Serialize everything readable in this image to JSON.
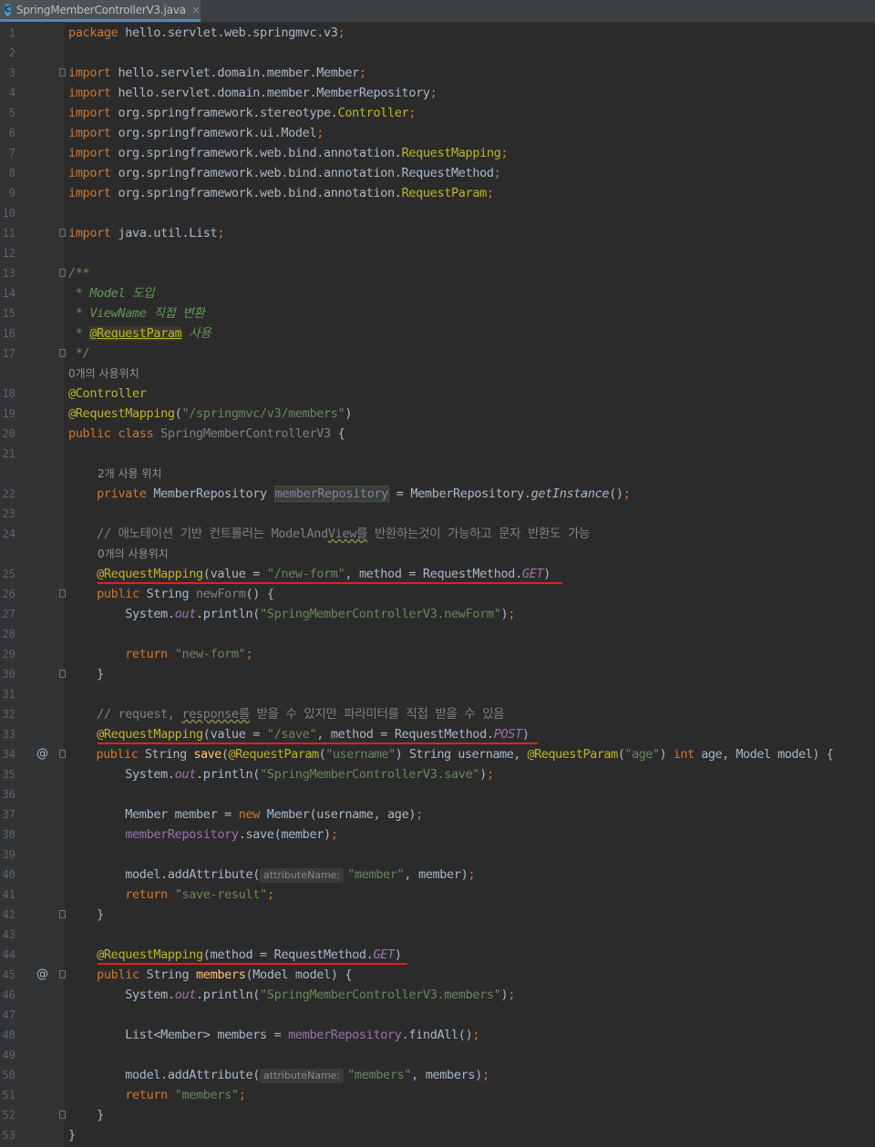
{
  "tab": {
    "icon_letter": "C",
    "title": "SpringMemberControllerV3.java",
    "close": "×"
  },
  "hints": {
    "h1": "0개의 사용위치",
    "h2": "2개 사용 위치",
    "h3": "0개의 사용위치"
  },
  "inlay_hint": "attributeName:",
  "line_numbers": [
    "1",
    "2",
    "3",
    "4",
    "5",
    "6",
    "7",
    "8",
    "9",
    "10",
    "11",
    "12",
    "13",
    "14",
    "15",
    "16",
    "17",
    "18",
    "19",
    "20",
    "21",
    "22",
    "23",
    "24",
    "25",
    "26",
    "27",
    "28",
    "29",
    "30",
    "31",
    "32",
    "33",
    "34",
    "35",
    "36",
    "37",
    "38",
    "39",
    "40",
    "41",
    "42",
    "43",
    "44",
    "45",
    "46",
    "47",
    "48",
    "49",
    "50",
    "51",
    "52",
    "53"
  ],
  "code": {
    "package_kw": "package",
    "package_name": " hello.servlet.web.springmvc.v3",
    "import_kw": "import",
    "imp1": " hello.servlet.domain.member.Member",
    "imp2": " hello.servlet.domain.member.MemberRepository",
    "imp3_pre": " org.springframework.stereotype.",
    "imp3_cls": "Controller",
    "imp4": " org.springframework.ui.Model",
    "imp5_pre": " org.springframework.web.bind.annotation.",
    "imp5_cls": "RequestMapping",
    "imp6": " org.springframework.web.bind.annotation.RequestMethod",
    "imp7_pre": " org.springframework.web.bind.annotation.",
    "imp7_cls": "RequestParam",
    "imp8": " java.util.List",
    "semi": ";",
    "doc_open": "/**",
    "doc1": " * Model 도입",
    "doc2": " * ViewName 직접 변환",
    "doc3_pre": " * ",
    "doc3_tag": "@RequestParam",
    "doc3_post": " 사용",
    "doc_close": " */",
    "ann_controller": "@Controller",
    "ann_reqmap": "@RequestMapping",
    "class_path": "\"/springmvc/v3/members\"",
    "public": "public",
    "class": "class",
    "class_name": " SpringMemberControllerV3 ",
    "private": "private",
    "repo_type": " MemberRepository ",
    "repo_field": "memberRepository",
    "repo_init": " = MemberRepository.",
    "get_instance": "getInstance",
    "comment1_pre": "// 애노테이션 기반 컨트롤러는 ModelAnd",
    "comment1_ul": "View를",
    "comment1_post": " 반환하는것이 가능하고 문자 반환도 가능",
    "value_eq": "value = ",
    "new_form_path": "\"/new-form\"",
    "method_eq": "method = RequestMethod.",
    "get": "GET",
    "post": "POST",
    "string": " String ",
    "new_form_fn": "newForm",
    "system_out": "System.",
    "out": "out",
    "println": ".println(",
    "str_newform": "\"SpringMemberControllerV3.newForm\"",
    "return": "return",
    "ret_newform": "\"new-form\"",
    "comment2_pre": "// request, ",
    "comment2_ul": "response를",
    "comment2_post": " 받을 수 있지만 파라미터를 직접 받을 수 있음",
    "save_path": "\"/save\"",
    "save_fn": "save",
    "ann_reqparam": "@RequestParam",
    "username_str": "\"username\"",
    "username_param": " String username, ",
    "age_str": "\"age\"",
    "int": "int",
    "age_param": " age, Model model) {",
    "str_save": "\"SpringMemberControllerV3.save\"",
    "member_decl": "Member member = ",
    "new": "new",
    "member_ctor": " Member(username, age)",
    "save_call": ".save(member)",
    "model_add": "model.addAttribute(",
    "member_str": "\"member\"",
    "member_arg": ", member)",
    "ret_save": "\"save-result\"",
    "members_fn": "members",
    "members_sig": "(Model model) {",
    "str_members": "\"SpringMemberControllerV3.members\"",
    "list_decl": "List<Member> members = ",
    "find_all": ".findAll()",
    "members_str": "\"members\"",
    "members_arg": ", members)",
    "ret_members": "\"members\"",
    "lbrace": "{",
    "rbrace": "}",
    "at": "@"
  }
}
